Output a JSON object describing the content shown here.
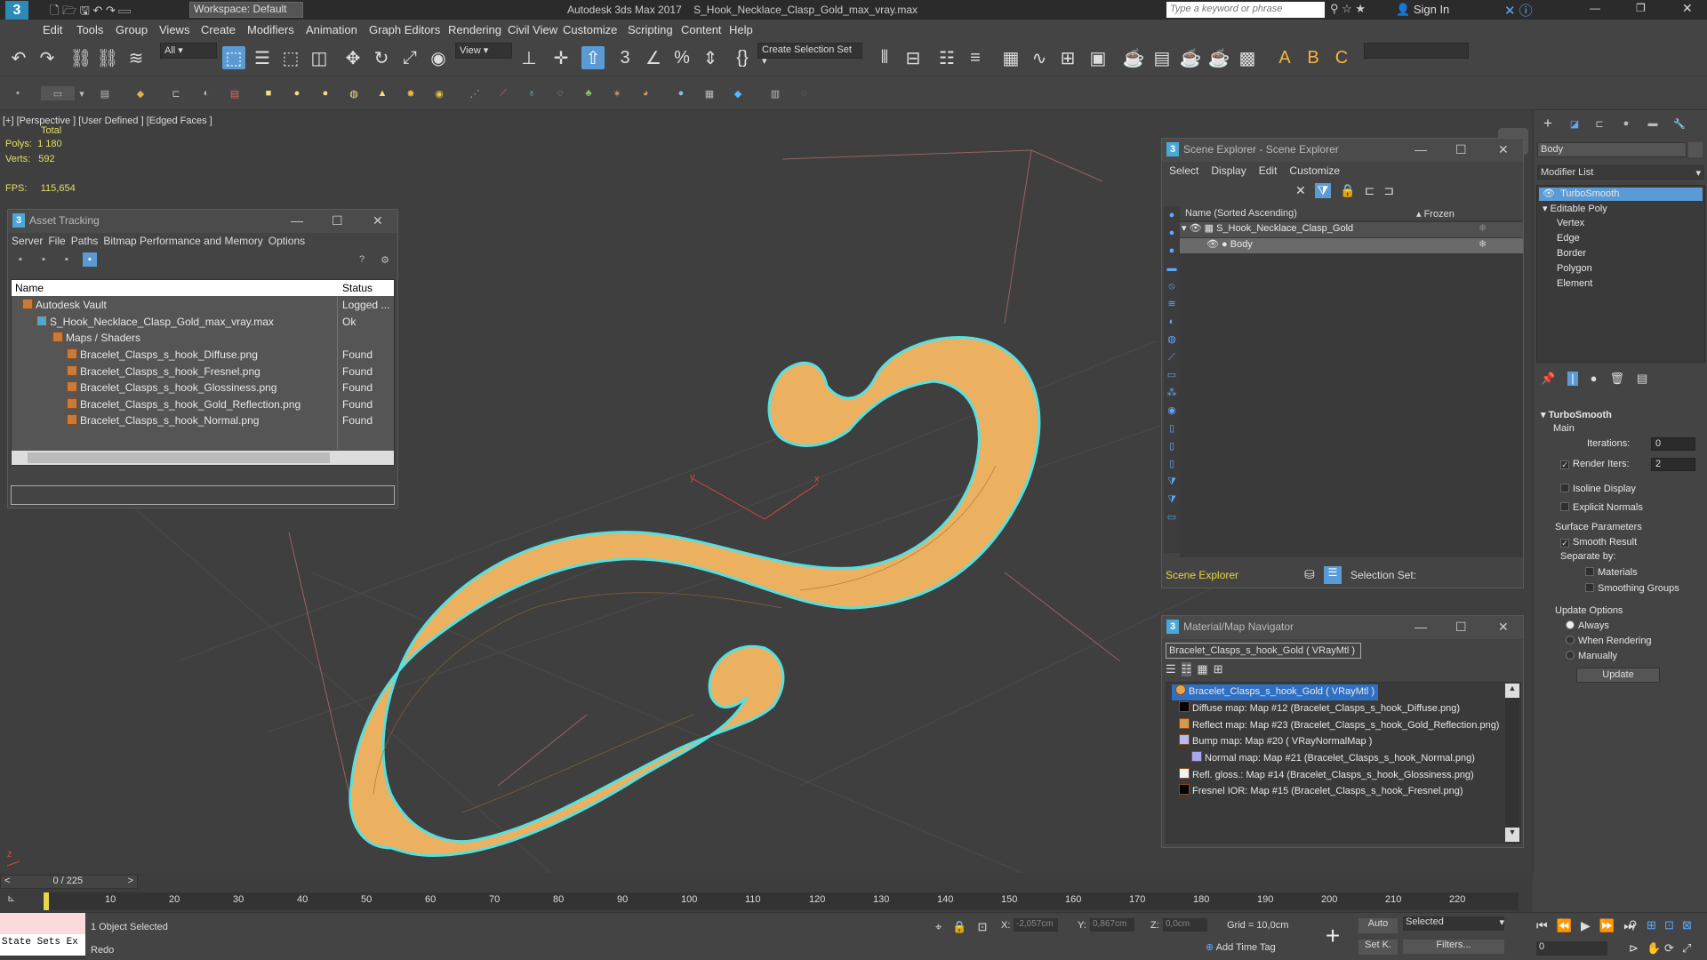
{
  "app": {
    "title": "Autodesk 3ds Max 2017",
    "file": "S_Hook_Necklace_Clasp_Gold_max_vray.max",
    "workspace": "Workspace: Default",
    "search_placeholder": "Type a keyword or phrase",
    "sign_in": "Sign In"
  },
  "menu": [
    "Edit",
    "Tools",
    "Group",
    "Views",
    "Create",
    "Modifiers",
    "Animation",
    "Graph Editors",
    "Rendering",
    "Civil View",
    "Customize",
    "Scripting",
    "Content",
    "Help"
  ],
  "toolbar": {
    "filter": "All",
    "refcoord": "View",
    "selection_set": "Create Selection Set"
  },
  "viewport": {
    "label": "[+] [Perspective ]  [User Defined ] [Edged Faces ]",
    "total": "Total",
    "polys_label": "Polys:",
    "polys": "1 180",
    "verts_label": "Verts:",
    "verts": "592",
    "fps_label": "FPS:",
    "fps": "115,654"
  },
  "asset_tracking": {
    "title": "Asset Tracking",
    "menu": [
      "Server",
      "File",
      "Paths",
      "Bitmap Performance and Memory",
      "Options"
    ],
    "col_name": "Name",
    "col_status": "Status",
    "rows": [
      {
        "name": "Autodesk Vault",
        "status": "Logged ..."
      },
      {
        "name": "S_Hook_Necklace_Clasp_Gold_max_vray.max",
        "status": "Ok"
      },
      {
        "name": "Maps / Shaders",
        "status": ""
      },
      {
        "name": "Bracelet_Clasps_s_hook_Diffuse.png",
        "status": "Found"
      },
      {
        "name": "Bracelet_Clasps_s_hook_Fresnel.png",
        "status": "Found"
      },
      {
        "name": "Bracelet_Clasps_s_hook_Glossiness.png",
        "status": "Found"
      },
      {
        "name": "Bracelet_Clasps_s_hook_Gold_Reflection.png",
        "status": "Found"
      },
      {
        "name": "Bracelet_Clasps_s_hook_Normal.png",
        "status": "Found"
      }
    ]
  },
  "scene_explorer": {
    "title": "Scene Explorer - Scene Explorer",
    "menu": [
      "Select",
      "Display",
      "Edit",
      "Customize"
    ],
    "col_name": "Name (Sorted Ascending)",
    "col_frozen": "Frozen",
    "items": [
      "S_Hook_Necklace_Clasp_Gold",
      "Body"
    ],
    "footer": "Scene Explorer",
    "selection_set": "Selection Set:"
  },
  "mat_nav": {
    "title": "Material/Map Navigator",
    "current": "Bracelet_Clasps_s_hook_Gold  ( VRayMtl )",
    "items": [
      {
        "label": "Bracelet_Clasps_s_hook_Gold  ( VRayMtl )",
        "color": "#e8a64a"
      },
      {
        "label": "Diffuse map: Map #12 (Bracelet_Clasps_s_hook_Diffuse.png)",
        "color": "#000000"
      },
      {
        "label": "Reflect map: Map #23 (Bracelet_Clasps_s_hook_Gold_Reflection.png)",
        "color": "#d29a4a"
      },
      {
        "label": "Bump map: Map #20  ( VRayNormalMap )",
        "color": "#b9b9f4"
      },
      {
        "label": "Normal map: Map #21 (Bracelet_Clasps_s_hook_Normal.png)",
        "color": "#a8a8ee"
      },
      {
        "label": "Refl. gloss.: Map #14 (Bracelet_Clasps_s_hook_Glossiness.png)",
        "color": "#f2f2f2"
      },
      {
        "label": "Fresnel IOR: Map #15 (Bracelet_Clasps_s_hook_Fresnel.png)",
        "color": "#000000"
      }
    ]
  },
  "command_panel": {
    "object_name": "Body",
    "modifier_list": "Modifier List",
    "stack": [
      "TurboSmooth",
      "Editable Poly",
      "Vertex",
      "Edge",
      "Border",
      "Polygon",
      "Element"
    ],
    "turbosmooth": {
      "title": "TurboSmooth",
      "main": "Main",
      "iterations_label": "Iterations:",
      "iterations": "0",
      "render_iters_label": "Render Iters:",
      "render_iters": "2",
      "isoline": "Isoline Display",
      "explicit": "Explicit Normals",
      "surface": "Surface Parameters",
      "smooth": "Smooth Result",
      "separate": "Separate by:",
      "materials": "Materials",
      "smoothing": "Smoothing Groups",
      "update_opts": "Update Options",
      "always": "Always",
      "when_rendering": "When Rendering",
      "manually": "Manually",
      "update": "Update"
    }
  },
  "timeline": {
    "frame": "0 / 225",
    "ticks": [
      "10",
      "20",
      "30",
      "40",
      "50",
      "60",
      "70",
      "80",
      "90",
      "100",
      "110",
      "120",
      "130",
      "140",
      "150",
      "160",
      "170",
      "180",
      "190",
      "200",
      "210",
      "220"
    ]
  },
  "status": {
    "state_sets": "State Sets Ex",
    "selected": "1 Object Selected",
    "prompt": "Redo",
    "x_label": "X:",
    "x": "-2,057cm",
    "y_label": "Y:",
    "y": "0,867cm",
    "z_label": "Z:",
    "z": "0,0cm",
    "grid": "Grid = 10,0cm",
    "add_time_tag": "Add Time Tag",
    "auto": "Auto",
    "set_k": "Set K.",
    "selected_mode": "Selected",
    "filters": "Filters...",
    "frame_field": "0"
  }
}
